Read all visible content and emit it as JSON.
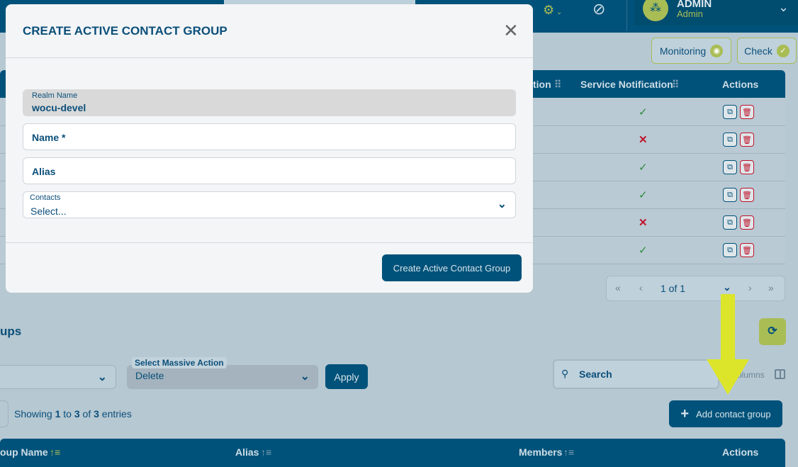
{
  "header": {
    "user_name": "ADMIN",
    "user_role": "Admin"
  },
  "toolbar": {
    "monitoring_label": "Monitoring",
    "check_label": "Check"
  },
  "top_table": {
    "columns": [
      "tion",
      "Service Notification",
      "Actions"
    ],
    "service_notification": [
      "check",
      "cross",
      "check",
      "check",
      "cross",
      "check"
    ]
  },
  "pagination": {
    "label": "1 of 1"
  },
  "section": {
    "title": "ups"
  },
  "massive_action": {
    "label": "Select Massive Action",
    "value": "Delete",
    "apply": "Apply"
  },
  "search": {
    "placeholder": "Search"
  },
  "columns_label": "olumns",
  "entries": {
    "prefix": "Showing ",
    "from": "1",
    "mid1": " to ",
    "to": "3",
    "mid2": " of ",
    "total": "3",
    "suffix": " entries"
  },
  "add_button": "Add contact group",
  "bottom_table": {
    "columns": [
      "oup Name",
      "Alias",
      "Members",
      "Actions"
    ]
  },
  "modal": {
    "title": "CREATE ACTIVE CONTACT GROUP",
    "realm_label": "Realm Name",
    "realm_value": "wocu-devel",
    "name_placeholder": "Name *",
    "alias_placeholder": "Alias",
    "contacts_label": "Contacts",
    "contacts_value": "Select...",
    "submit": "Create Active Contact Group"
  },
  "colors": {
    "primary": "#00527a",
    "accent": "#a9bd55",
    "arrow": "#dde52a",
    "overlay": "#b6c8d2"
  }
}
